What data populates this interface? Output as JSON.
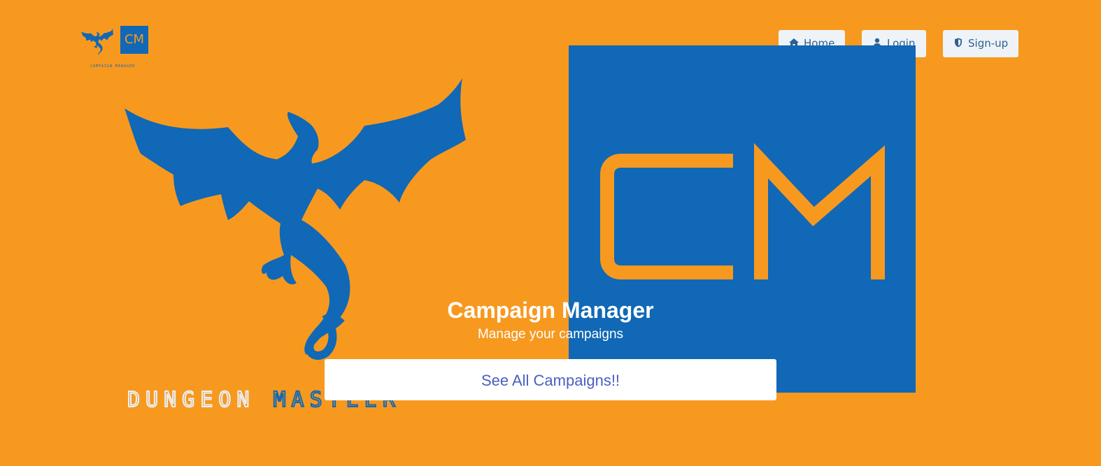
{
  "colors": {
    "background": "#f7991f",
    "brand_blue": "#1068b6",
    "nav_bg": "#eef3f8",
    "nav_text": "#2f5f8f",
    "cta_text": "#4a5fc1"
  },
  "header": {
    "logo": {
      "mini_mark": "CM",
      "caption": "CAMPAIGN MANAGER"
    },
    "nav": [
      {
        "label": "Home",
        "icon": "home-icon"
      },
      {
        "label": "Login",
        "icon": "user-icon"
      },
      {
        "label": "Sign-up",
        "icon": "shield-icon"
      }
    ]
  },
  "hero": {
    "brand_word_1": "DUNGEON",
    "brand_word_2": "MASTEER",
    "title": "Campaign Manager",
    "subtitle": "Manage your campaigns",
    "cta_label": "See All Campaigns!!"
  }
}
